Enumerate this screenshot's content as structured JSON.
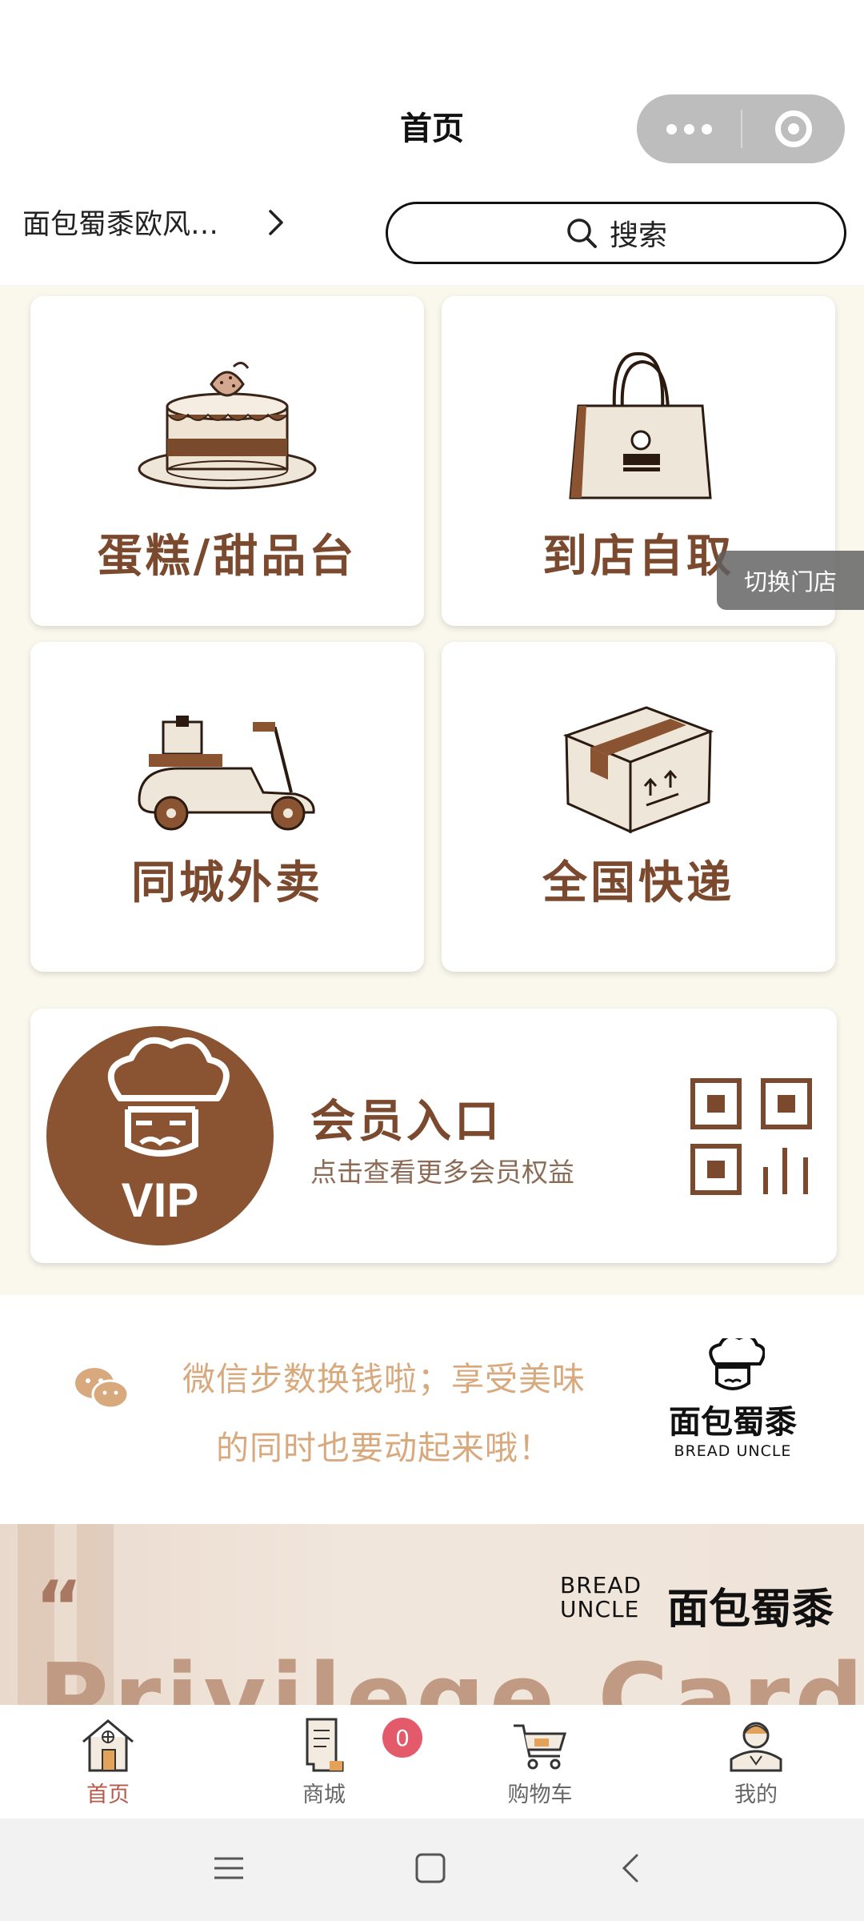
{
  "header": {
    "title": "首页"
  },
  "store": {
    "name": "面包蜀黍欧风…"
  },
  "search": {
    "label": "搜索"
  },
  "tiles": [
    {
      "label": "蛋糕/甜品台",
      "icon": "cake-icon"
    },
    {
      "label": "到店自取",
      "icon": "shopping-bag-icon"
    },
    {
      "label": "同城外卖",
      "icon": "scooter-icon"
    },
    {
      "label": "全国快递",
      "icon": "parcel-box-icon"
    }
  ],
  "switch_store": {
    "label": "切换门店"
  },
  "vip": {
    "badge_text": "VIP",
    "title": "会员入口",
    "subtitle": "点击查看更多会员权益"
  },
  "wechat_steps": {
    "line1": "微信步数换钱啦；享受美味",
    "line2": "的同时也要动起来哦！"
  },
  "brand": {
    "cn": "面包蜀黍",
    "en": "BREAD UNCLE"
  },
  "banner": {
    "quote": "“",
    "headline": "Privilege Card",
    "logo_en_1": "BREAD",
    "logo_en_2": "UNCLE",
    "logo_cn": "面包蜀黍"
  },
  "tabbar": {
    "items": [
      {
        "label": "首页",
        "icon": "home-icon",
        "active": true
      },
      {
        "label": "商城",
        "icon": "document-icon",
        "active": false
      },
      {
        "label": "购物车",
        "icon": "cart-icon",
        "active": false
      },
      {
        "label": "我的",
        "icon": "user-icon",
        "active": false
      }
    ],
    "cart_count": "0"
  },
  "colors": {
    "brand_brown": "#7b4a2e",
    "cream_bg": "#faf7ec",
    "accent_tab": "#b8584a",
    "badge": "#e35a6b",
    "wechat_text": "#d8a97d"
  }
}
